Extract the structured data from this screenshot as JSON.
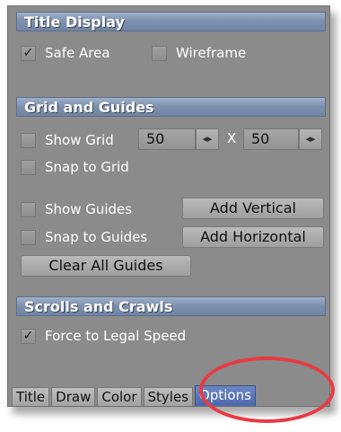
{
  "title_display": {
    "header": "Title Display",
    "safe_area": {
      "label": "Safe Area",
      "checked": true
    },
    "wireframe": {
      "label": "Wireframe",
      "checked": false
    }
  },
  "grid_guides": {
    "header": "Grid and Guides",
    "show_grid": {
      "label": "Show Grid",
      "checked": false
    },
    "grid_x": "50",
    "separator": "X",
    "grid_y": "50",
    "spin_glyph": "◂▸",
    "snap_to_grid": {
      "label": "Snap to Grid",
      "checked": false
    },
    "show_guides": {
      "label": "Show Guides",
      "checked": false
    },
    "snap_to_guides": {
      "label": "Snap to Guides",
      "checked": false
    },
    "add_vertical": "Add Vertical",
    "add_horizontal": "Add Horizontal",
    "clear_all_guides": "Clear All Guides"
  },
  "scrolls_crawls": {
    "header": "Scrolls and Crawls",
    "force_legal_speed": {
      "label": "Force to Legal Speed",
      "checked": true
    }
  },
  "tabs": [
    {
      "label": "Title",
      "active": false
    },
    {
      "label": "Draw",
      "active": false
    },
    {
      "label": "Color",
      "active": false
    },
    {
      "label": "Styles",
      "active": false
    },
    {
      "label": "Options",
      "active": true
    }
  ],
  "checkmark": "✓",
  "colors": {
    "panel": "#8b8b8b",
    "header": "#7e92b0",
    "active_tab": "#4d67ad",
    "annotation": "#e83a43"
  }
}
